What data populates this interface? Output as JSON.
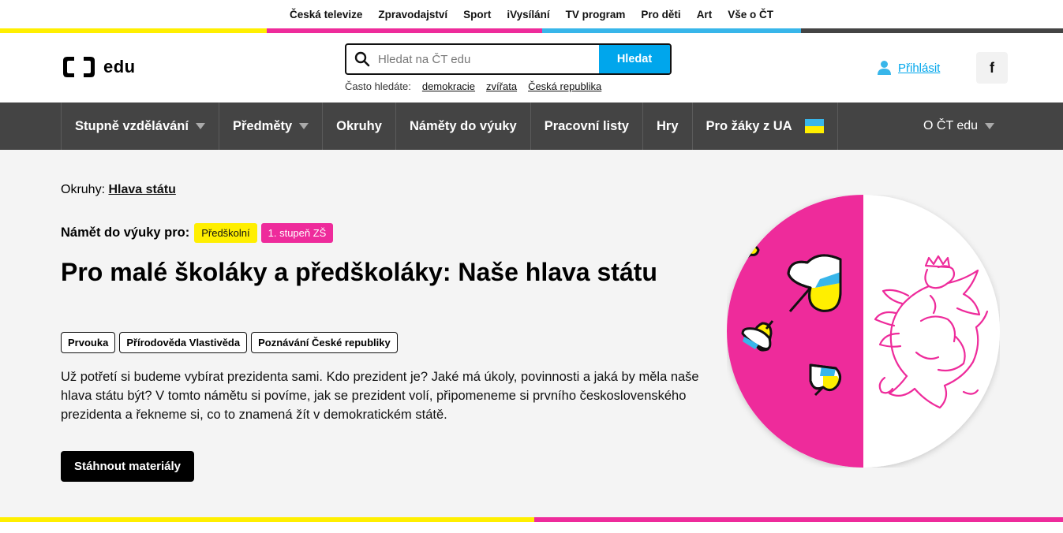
{
  "topnav": [
    "Česká televize",
    "Zpravodajství",
    "Sport",
    "iVysílání",
    "TV program",
    "Pro děti",
    "Art",
    "Vše o ČT"
  ],
  "logo": {
    "text": "edu"
  },
  "search": {
    "placeholder": "Hledat na ČT edu",
    "button": "Hledat"
  },
  "frequent": {
    "label": "Často hledáte:",
    "links": [
      "demokracie",
      "zvířata",
      "Česká republika"
    ]
  },
  "login": {
    "label": "Přihlásit"
  },
  "social": {
    "facebook": "f"
  },
  "nav": {
    "items": [
      "Stupně vzdělávání",
      "Předměty",
      "Okruhy",
      "Náměty do výuky",
      "Pracovní listy",
      "Hry",
      "Pro žáky z UA"
    ],
    "about": "O ČT edu"
  },
  "breadcrumb": {
    "label": "Okruhy:",
    "link": "Hlava státu"
  },
  "levels": {
    "label": "Námět do výuky pro:",
    "badges": [
      "Předškolní",
      "1. stupeň ZŠ"
    ]
  },
  "title": "Pro malé školáky a předškoláky: Naše hlava státu",
  "tags": [
    "Prvouka",
    "Přírodověda Vlastivěda",
    "Poznávání České republiky"
  ],
  "description": "Už potřetí si budeme vybírat prezidenta sami. Kdo prezident je? Jaké má úkoly, povinnosti a jaká by měla naše hlava státu být? V tomto námětu si povíme, jak se prezident volí, připomeneme si prvního československého prezidenta a řekneme si, co to znamená žít v demokratickém státě.",
  "cta": "Stáhnout materiály",
  "colors": {
    "yellow": "#ffef00",
    "pink": "#ee2b9b",
    "blue": "#38b6ea",
    "dark": "#444444",
    "accent": "#00a6ec"
  },
  "icons": [
    "search-icon",
    "user-icon",
    "facebook-icon",
    "chevron-down-icon",
    "ukraine-flag-icon"
  ]
}
